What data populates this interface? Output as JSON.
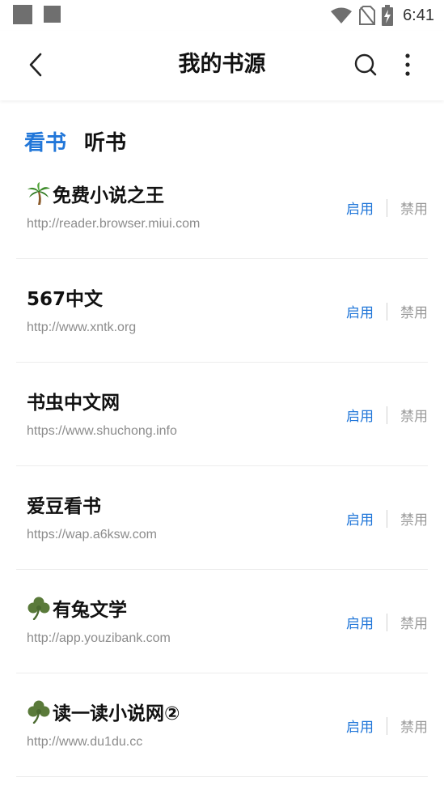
{
  "status_bar": {
    "time": "6:41"
  },
  "app_bar": {
    "title": "我的书源"
  },
  "tabs": [
    {
      "label": "看书",
      "active": true
    },
    {
      "label": "听书",
      "active": false
    }
  ],
  "sources": [
    {
      "icon": "palm-tree-icon",
      "name": "免费小说之王",
      "url": "http://reader.browser.miui.com",
      "enable_label": "启用",
      "disable_label": "禁用"
    },
    {
      "icon": "",
      "name": "567中文",
      "url": "http://www.xntk.org",
      "enable_label": "启用",
      "disable_label": "禁用"
    },
    {
      "icon": "",
      "name": "书虫中文网",
      "url": "https://www.shuchong.info",
      "enable_label": "启用",
      "disable_label": "禁用"
    },
    {
      "icon": "",
      "name": "爱豆看书",
      "url": "https://wap.a6ksw.com",
      "enable_label": "启用",
      "disable_label": "禁用"
    },
    {
      "icon": "clover-icon",
      "name": "有兔文学",
      "url": "http://app.youzibank.com",
      "enable_label": "启用",
      "disable_label": "禁用"
    },
    {
      "icon": "clover-icon",
      "name": "读一读小说网②",
      "url": "http://www.du1du.cc",
      "enable_label": "启用",
      "disable_label": "禁用"
    }
  ],
  "colors": {
    "accent": "#2277d9",
    "muted_text": "#8c8c8c",
    "disabled_action": "#9a9a9a"
  }
}
